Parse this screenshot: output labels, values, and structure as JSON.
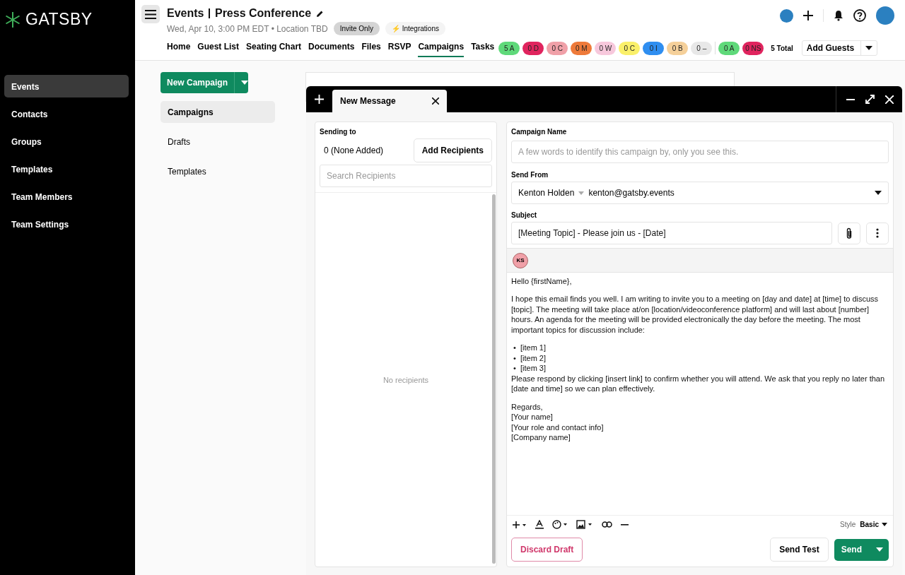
{
  "brand": "GATSBY",
  "sidebar": {
    "items": [
      {
        "label": "Events",
        "selected": true
      },
      {
        "label": "Contacts",
        "selected": false
      },
      {
        "label": "Groups",
        "selected": false
      },
      {
        "label": "Templates",
        "selected": false
      },
      {
        "label": "Team Members",
        "selected": false
      },
      {
        "label": "Team Settings",
        "selected": false
      }
    ]
  },
  "header": {
    "title": "Events",
    "event_name": "Press Conference",
    "subtitle": "Wed, Apr 10, 3:00 PM EDT • Location TBD",
    "invite_badge": "Invite Only",
    "integrations": "⚡ Integrations",
    "tabs": [
      {
        "label": "Home",
        "selected": false
      },
      {
        "label": "Guest List",
        "selected": false
      },
      {
        "label": "Seating Chart",
        "selected": false
      },
      {
        "label": "Documents",
        "selected": false
      },
      {
        "label": "Files",
        "selected": false
      },
      {
        "label": "RSVP",
        "selected": false
      },
      {
        "label": "Campaigns",
        "selected": true
      },
      {
        "label": "Tasks",
        "selected": false
      }
    ],
    "pills": [
      {
        "label": "5 A",
        "color": "#5fd97a"
      },
      {
        "label": "0 D",
        "color": "#e0245e"
      },
      {
        "label": "0 C",
        "color": "#f0a0a8"
      },
      {
        "label": "0 M",
        "color": "#ee7a3a"
      },
      {
        "label": "0 W",
        "color": "#f7c8dc"
      },
      {
        "label": "0 C",
        "color": "#faf06a"
      },
      {
        "label": "0 I",
        "color": "#2f8ef0"
      },
      {
        "label": "0 B",
        "color": "#f5d09a"
      },
      {
        "label": "0 –",
        "color": "#e8e8e8"
      },
      {
        "label": "0 A",
        "color": "#5fd97a"
      },
      {
        "label": "0 NS",
        "color": "#e0245e"
      }
    ],
    "total": "5 Total",
    "add_guests": "Add Guests"
  },
  "campaign_nav": {
    "new_button": "New Campaign",
    "items": [
      {
        "label": "Campaigns",
        "selected": true
      },
      {
        "label": "Drafts",
        "selected": false
      },
      {
        "label": "Templates",
        "selected": false
      }
    ]
  },
  "composer": {
    "tab": "New Message",
    "sending_to_label": "Sending to",
    "recipient_count": "0 (None Added)",
    "add_recipients": "Add Recipients",
    "search_placeholder": "Search Recipients",
    "empty_text": "No recipients",
    "campaign_name_label": "Campaign Name",
    "campaign_name_placeholder": "A few words to identify this campaign by, only you see this.",
    "send_from_label": "Send From",
    "sender_name": "Kenton Holden",
    "sender_email": "kenton@gatsby.events",
    "subject_label": "Subject",
    "subject": "[Meeting Topic] - Please join us - [Date]",
    "avatar_initials": "KS",
    "body": {
      "greeting": "Hello {firstName},",
      "intro": "I hope this email finds you well. I am writing to invite you to a meeting on [day and date] at [time] to discuss [topic]. The meeting will take place at/on [location/videoconference platform] and will last about [number] hours. An agenda for the meeting will be provided electronically the day before the meeting. The most important topics for discussion include:",
      "items": [
        {
          "marker": "•",
          "text": "[item 1]"
        },
        {
          "marker": "•",
          "text": "[item 2]"
        },
        {
          "marker": "•",
          "text": "[item 3]"
        }
      ],
      "request": "Please respond by clicking [insert link] to confirm whether you will attend. We ask that you reply no later than [date and time] so we can plan effectively.",
      "signature": [
        "Regards,",
        "[Your name]",
        "[Your role and contact info]",
        "[Company name]"
      ]
    },
    "style_label": "Style",
    "style_value": "Basic",
    "discard": "Discard Draft",
    "send_test": "Send Test",
    "send": "Send"
  }
}
